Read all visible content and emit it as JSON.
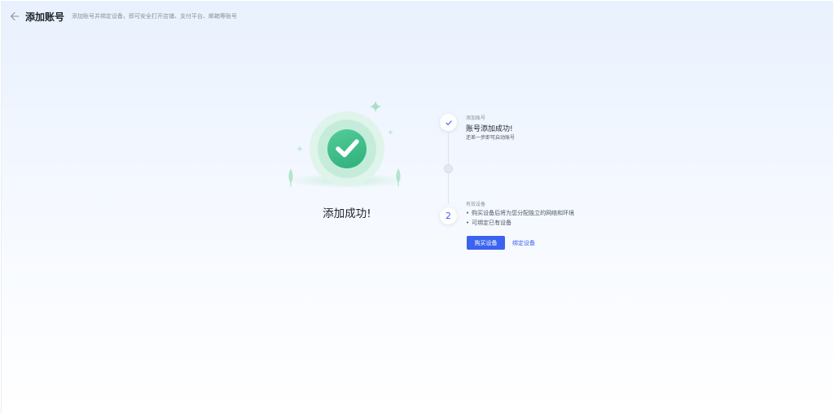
{
  "header": {
    "back_icon": "arrow-left-icon",
    "title": "添加账号",
    "subtitle": "添加账号并绑定设备，即可安全打开店铺、支付平台、邮箱等账号"
  },
  "result": {
    "icon": "check-circle-icon",
    "text": "添加成功!"
  },
  "steps": [
    {
      "marker_icon": "check-icon",
      "label": "添加账号",
      "title": "账号添加成功!",
      "description": "还差一步即可启动账号"
    },
    {
      "number": "2",
      "label": "有效设备",
      "bullets": [
        "购买设备后将为您分配独立的网络和环境",
        "可绑定已有设备"
      ],
      "primary_button": "购买设备",
      "link_button": "绑定设备"
    }
  ],
  "colors": {
    "accent": "#3a63f0",
    "success": "#2fb07b",
    "text_primary": "#1f2329",
    "text_secondary": "#8a9099"
  }
}
